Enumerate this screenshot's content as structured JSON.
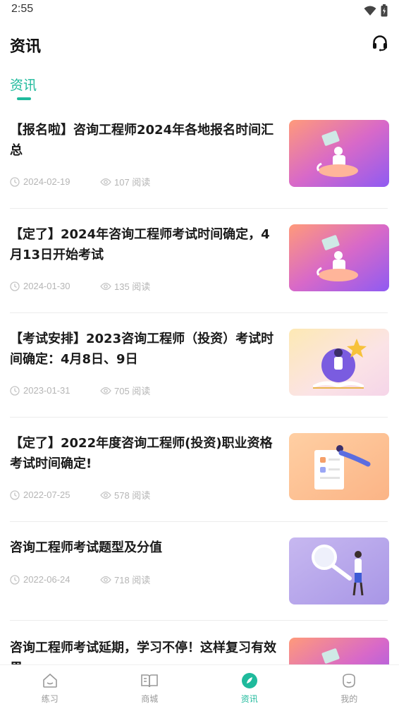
{
  "status_bar": {
    "time": "2:55"
  },
  "header": {
    "title": "资讯"
  },
  "tabs": [
    {
      "label": "资讯",
      "active": true
    }
  ],
  "articles": [
    {
      "title": "【报名啦】咨询工程师2024年各地报名时间汇总",
      "date": "2024-02-19",
      "views": "107 阅读",
      "thumbnail": "rocket-rider-illustration"
    },
    {
      "title": "【定了】2024年咨询工程师考试时间确定，4月13日开始考试",
      "date": "2024-01-30",
      "views": "135 阅读",
      "thumbnail": "rocket-rider-illustration"
    },
    {
      "title": "【考试安排】2023咨询工程师（投资）考试时间确定：4月8日、9日",
      "date": "2023-01-31",
      "views": "705 阅读",
      "thumbnail": "star-book-illustration"
    },
    {
      "title": "【定了】2022年度咨询工程师(投资)职业资格考试时间确定!",
      "date": "2022-07-25",
      "views": "578 阅读",
      "thumbnail": "document-flyer-illustration"
    },
    {
      "title": "咨询工程师考试题型及分值",
      "date": "2022-06-24",
      "views": "718 阅读",
      "thumbnail": "magnifier-person-illustration"
    },
    {
      "title": "咨询工程师考试延期，学习不停！这样复习有效果",
      "date": "",
      "views": "",
      "thumbnail": "rocket-rider-illustration"
    }
  ],
  "bottom_nav": [
    {
      "label": "练习",
      "icon": "practice-icon",
      "active": false
    },
    {
      "label": "商城",
      "icon": "book-icon",
      "active": false
    },
    {
      "label": "资讯",
      "icon": "compass-icon",
      "active": true
    },
    {
      "label": "我的",
      "icon": "profile-icon",
      "active": false
    }
  ],
  "colors": {
    "accent": "#1fba9c",
    "meta": "#b5b5b5",
    "nav_inactive": "#999999"
  }
}
